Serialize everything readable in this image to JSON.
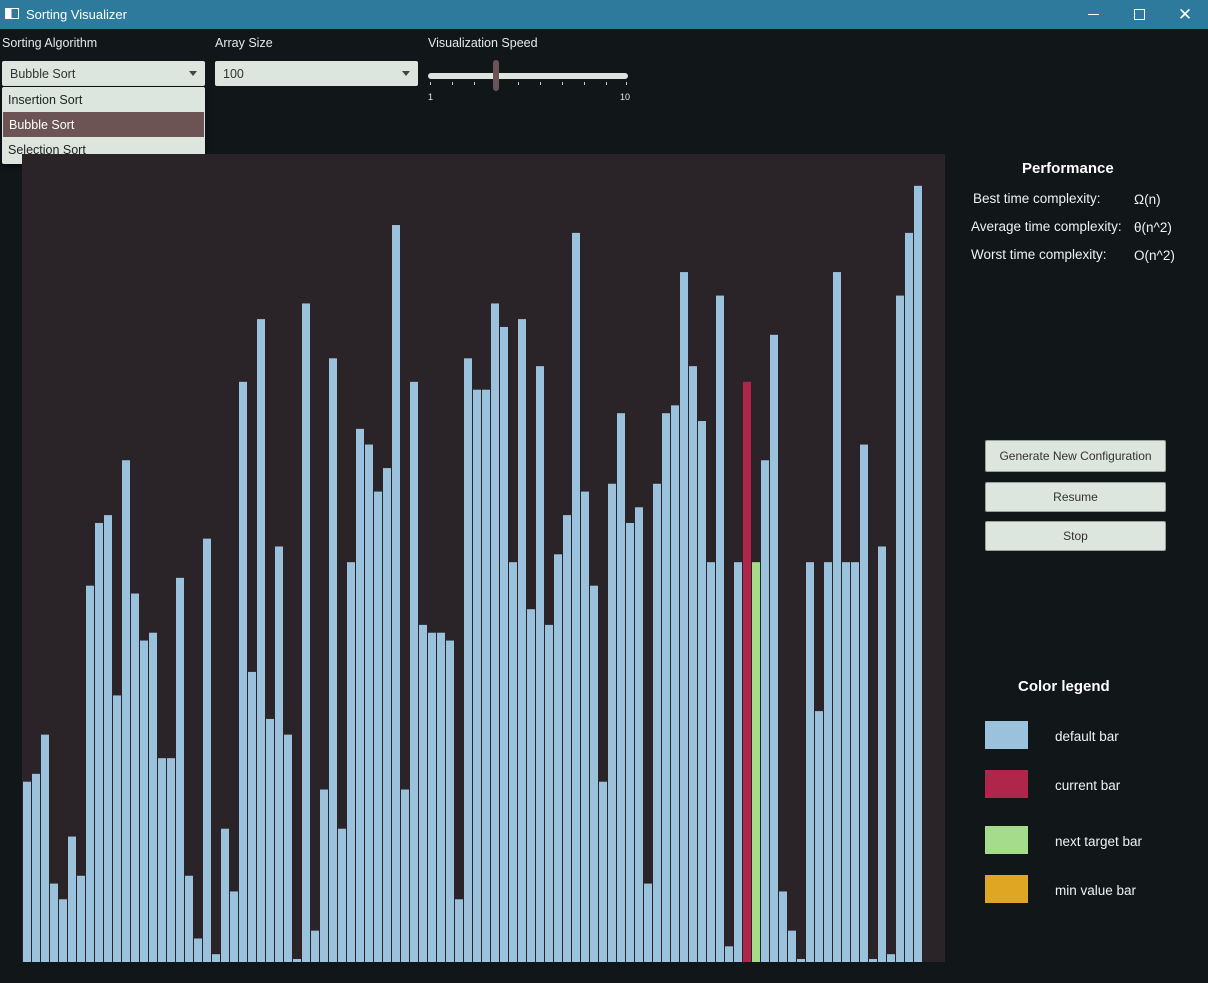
{
  "window": {
    "title": "Sorting Visualizer",
    "min_label": "—",
    "max_label": "□",
    "close_label": "✕"
  },
  "controls": {
    "algorithm_label": "Sorting Algorithm",
    "algorithm_value": "Bubble Sort",
    "algorithm_options": [
      "Insertion Sort",
      "Bubble Sort",
      "Selection Sort"
    ],
    "array_size_label": "Array Size",
    "array_size_value": "100",
    "speed_label": "Visualization Speed",
    "speed_min": "1",
    "speed_max": "10",
    "speed_value": 4
  },
  "performance": {
    "title": "Performance",
    "best_label": "Best time complexity:",
    "best_value": "Ω(n)",
    "average_label": "Average time complexity:",
    "average_value": "θ(n^2)",
    "worst_label": "Worst time complexity:",
    "worst_value": "O(n^2)"
  },
  "buttons": {
    "generate": "Generate New Configuration",
    "resume": "Resume",
    "stop": "Stop"
  },
  "legend": {
    "title": "Color legend",
    "items": [
      {
        "label": "default bar",
        "color": "#9bc2dc"
      },
      {
        "label": "current bar",
        "color": "#b0264a"
      },
      {
        "label": "next target bar",
        "color": "#a5dc8c"
      },
      {
        "label": "min value bar",
        "color": "#dfa623"
      }
    ]
  },
  "chart_data": {
    "type": "bar",
    "ylim": [
      0,
      100
    ],
    "current_index": 80,
    "next_index": 81,
    "values": [
      23,
      24,
      29,
      10,
      8,
      16,
      11,
      48,
      56,
      57,
      34,
      64,
      47,
      41,
      42,
      26,
      26,
      49,
      11,
      3,
      54,
      1,
      17,
      9,
      74,
      37,
      82,
      31,
      53,
      29,
      0,
      84,
      4,
      22,
      77,
      17,
      51,
      68,
      66,
      60,
      63,
      94,
      22,
      74,
      43,
      42,
      42,
      41,
      8,
      77,
      73,
      73,
      84,
      81,
      51,
      82,
      45,
      76,
      43,
      52,
      57,
      93,
      60,
      48,
      23,
      61,
      70,
      56,
      58,
      10,
      61,
      70,
      71,
      88,
      76,
      69,
      51,
      85,
      2,
      51,
      74,
      51,
      64,
      80,
      9,
      4,
      0,
      51,
      32,
      51,
      88,
      51,
      51,
      66,
      0,
      53,
      1,
      85,
      93,
      99
    ]
  }
}
